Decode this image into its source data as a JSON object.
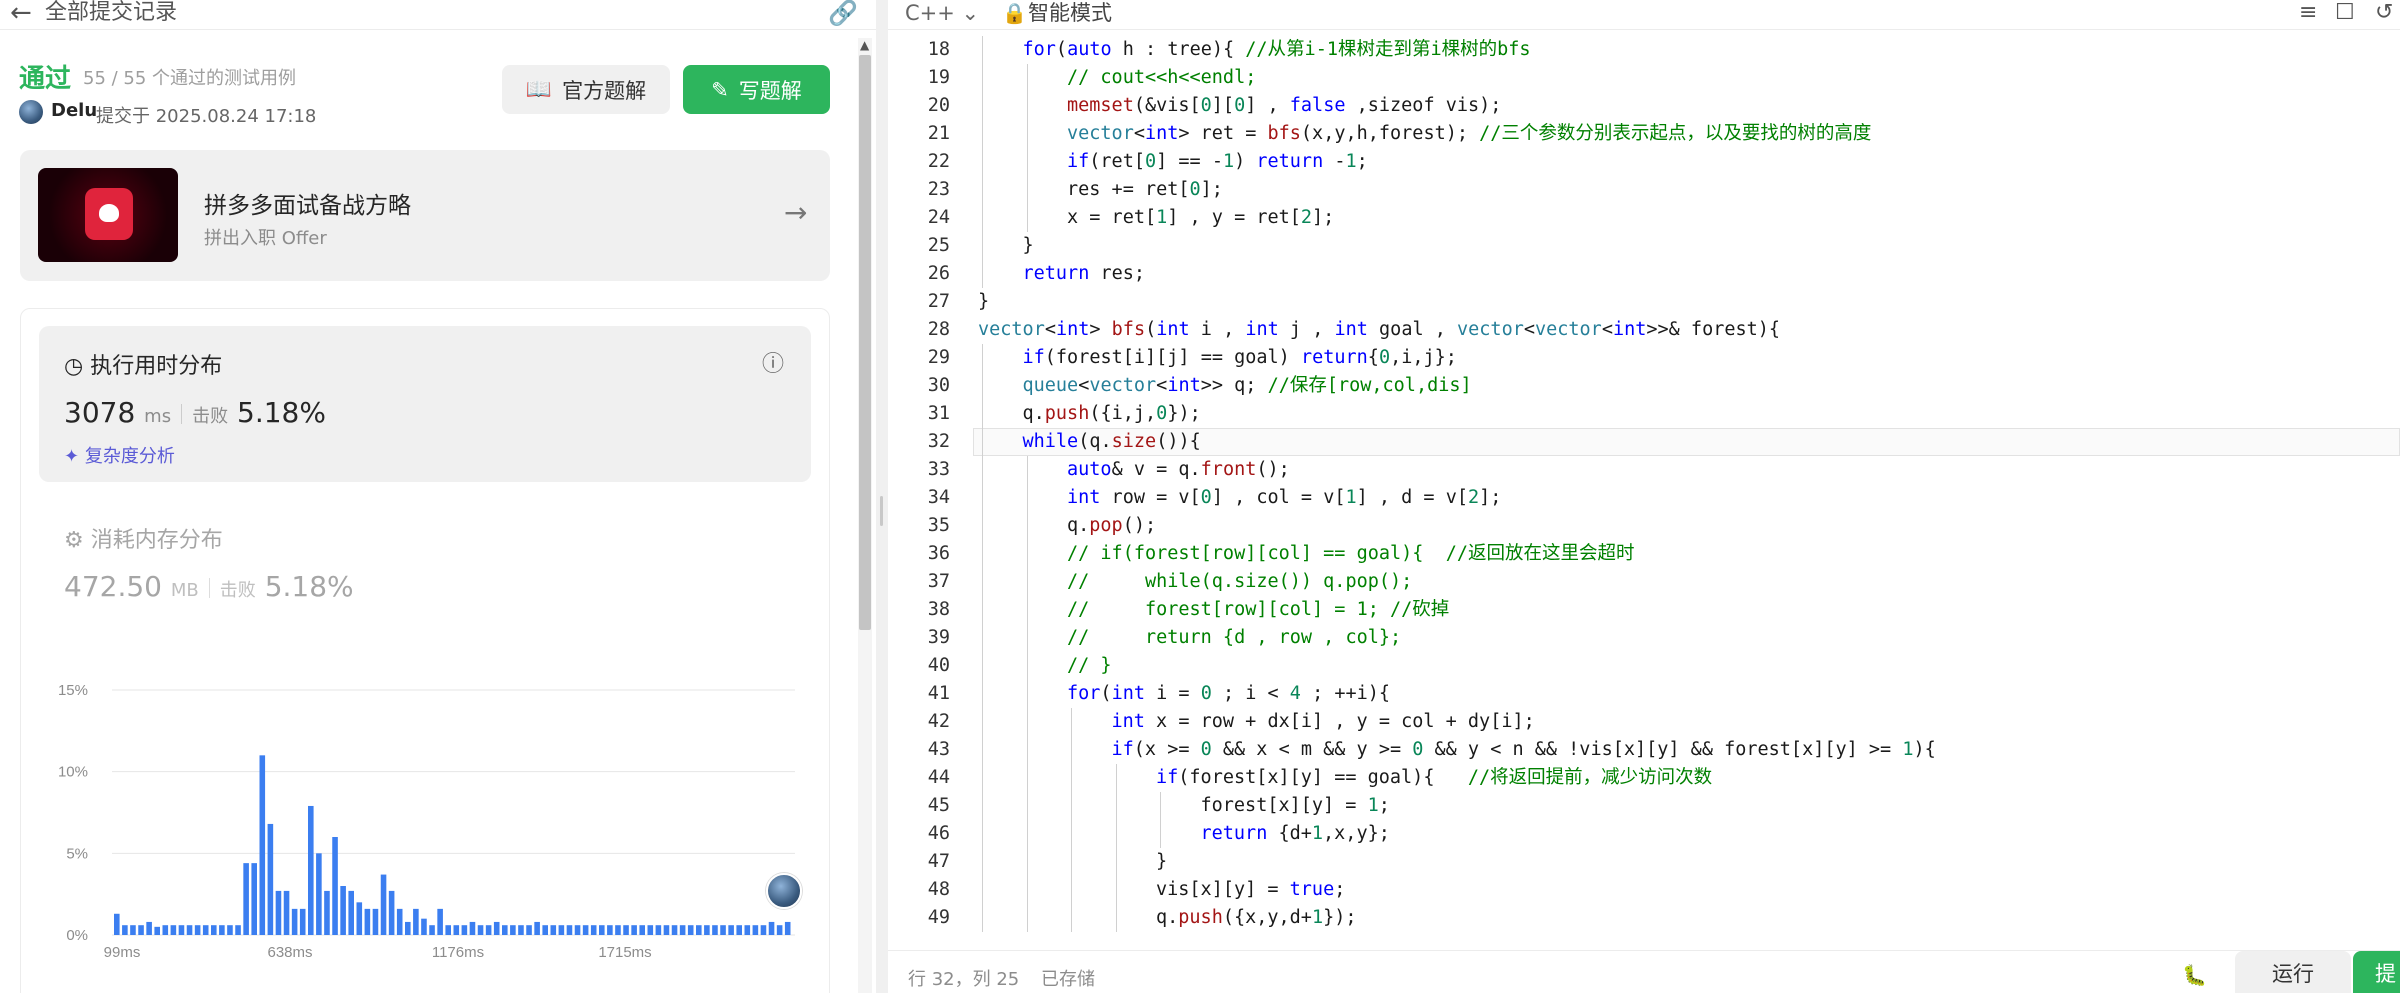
{
  "left_header": {
    "back_icon": "arrow-left-icon",
    "title": "全部提交记录",
    "link_icon": "link-icon"
  },
  "result": {
    "status": "通过",
    "passed_text": "55 / 55 个通过的测试用例",
    "author": "Delu",
    "submitted_at": "提交于 2025.08.24 17:18",
    "official_solution": "官方题解",
    "write_solution": "写题解",
    "accent_color": "#2db55d"
  },
  "ad": {
    "title": "拼多多面试备战方略",
    "subtitle": "拼出入职 Offer"
  },
  "runtime": {
    "heading": "执行用时分布",
    "value": "3078",
    "unit": "ms",
    "beat_label": "击败",
    "beat_pct": "5.18%",
    "complexity": "复杂度分析"
  },
  "memory": {
    "heading": "消耗内存分布",
    "value": "472.50",
    "unit": "MB",
    "beat_label": "击败",
    "beat_pct": "5.18%"
  },
  "chart_data": {
    "type": "bar",
    "y_tick_labels": [
      "0%",
      "5%",
      "10%",
      "15%"
    ],
    "ylim": [
      0,
      15
    ],
    "x_tick_labels": [
      "99ms",
      "638ms",
      "1176ms",
      "1715ms"
    ],
    "bar_color": "#3b7ef0",
    "values": [
      1.3,
      0.6,
      0.6,
      0.6,
      0.8,
      0.5,
      0.6,
      0.6,
      0.6,
      0.6,
      0.6,
      0.6,
      0.6,
      0.6,
      0.6,
      0.6,
      4.4,
      4.4,
      11,
      6.8,
      2.7,
      2.7,
      1.6,
      1.6,
      7.9,
      5,
      2.7,
      6,
      3,
      2.7,
      2,
      1.6,
      1.6,
      3.7,
      2.7,
      1.6,
      0.8,
      1.6,
      1,
      0.6,
      1.6,
      0.6,
      0.6,
      0.6,
      0.8,
      0.6,
      0.6,
      0.8,
      0.6,
      0.6,
      0.6,
      0.6,
      0.8,
      0.6,
      0.6,
      0.6,
      0.6,
      0.6,
      0.6,
      0.6,
      0.6,
      0.6,
      0.6,
      0.6,
      0.6,
      0.6,
      0.6,
      0.6,
      0.6,
      0.6,
      0.6,
      0.6,
      0.6,
      0.6,
      0.6,
      0.6,
      0.6,
      0.6,
      0.6,
      0.6,
      0.6,
      0.8,
      0.6,
      0.8
    ]
  },
  "editor": {
    "language": "C++",
    "mode": "智能模式",
    "position": "行 32，列 25",
    "saved": "已存储",
    "run": "运行",
    "submit": "提"
  },
  "code_lines": [
    {
      "no": "18",
      "ind": 1,
      "tokens": [
        [
          "k",
          "for"
        ],
        [
          "",
          "("
        ],
        [
          "k",
          "auto"
        ],
        [
          "",
          " h : tree){ "
        ],
        [
          "c",
          "//从第i-1棵树走到第i棵树的bfs"
        ]
      ]
    },
    {
      "no": "19",
      "ind": 2,
      "tokens": [
        [
          "c",
          "// cout<<h<<endl;"
        ]
      ]
    },
    {
      "no": "20",
      "ind": 2,
      "tokens": [
        [
          "s",
          "memset"
        ],
        [
          "",
          "(&vis["
        ],
        [
          "n",
          "0"
        ],
        [
          "",
          "]["
        ],
        [
          "n",
          "0"
        ],
        [
          "",
          "] , "
        ],
        [
          "k",
          "false"
        ],
        [
          "",
          " ,sizeof vis);"
        ]
      ]
    },
    {
      "no": "21",
      "ind": 2,
      "tokens": [
        [
          "t",
          "vector"
        ],
        [
          "",
          "<"
        ],
        [
          "k",
          "int"
        ],
        [
          "",
          "> ret = "
        ],
        [
          "s",
          "bfs"
        ],
        [
          "",
          "(x,y,h,forest); "
        ],
        [
          "c",
          "//三个参数分别表示起点，以及要找的树的高度"
        ]
      ]
    },
    {
      "no": "22",
      "ind": 2,
      "tokens": [
        [
          "k",
          "if"
        ],
        [
          "",
          "(ret["
        ],
        [
          "n",
          "0"
        ],
        [
          "",
          "] == -"
        ],
        [
          "n",
          "1"
        ],
        [
          "",
          ") "
        ],
        [
          "k",
          "return"
        ],
        [
          "",
          " -"
        ],
        [
          "n",
          "1"
        ],
        [
          "",
          ";"
        ]
      ]
    },
    {
      "no": "23",
      "ind": 2,
      "tokens": [
        [
          "",
          "res += ret["
        ],
        [
          "n",
          "0"
        ],
        [
          "",
          "];"
        ]
      ]
    },
    {
      "no": "24",
      "ind": 2,
      "tokens": [
        [
          "",
          "x = ret["
        ],
        [
          "n",
          "1"
        ],
        [
          "",
          "] , y = ret["
        ],
        [
          "n",
          "2"
        ],
        [
          "",
          "];"
        ]
      ]
    },
    {
      "no": "25",
      "ind": 1,
      "tokens": [
        [
          "",
          "}"
        ]
      ]
    },
    {
      "no": "26",
      "ind": 1,
      "tokens": [
        [
          "k",
          "return"
        ],
        [
          "",
          " res;"
        ]
      ]
    },
    {
      "no": "27",
      "ind": 0,
      "tokens": [
        [
          "",
          "}"
        ]
      ]
    },
    {
      "no": "28",
      "ind": 0,
      "tokens": [
        [
          "t",
          "vector"
        ],
        [
          "",
          "<"
        ],
        [
          "k",
          "int"
        ],
        [
          "",
          "> "
        ],
        [
          "s",
          "bfs"
        ],
        [
          "",
          "("
        ],
        [
          "k",
          "int"
        ],
        [
          "",
          " i , "
        ],
        [
          "k",
          "int"
        ],
        [
          "",
          " j , "
        ],
        [
          "k",
          "int"
        ],
        [
          "",
          " goal , "
        ],
        [
          "t",
          "vector"
        ],
        [
          "",
          "<"
        ],
        [
          "t",
          "vector"
        ],
        [
          "",
          "<"
        ],
        [
          "k",
          "int"
        ],
        [
          "",
          ">>& forest){"
        ]
      ]
    },
    {
      "no": "29",
      "ind": 1,
      "tokens": [
        [
          "k",
          "if"
        ],
        [
          "",
          "(forest[i][j] == goal) "
        ],
        [
          "k",
          "return"
        ],
        [
          "",
          "{"
        ],
        [
          "n",
          "0"
        ],
        [
          "",
          ",i,j};"
        ]
      ]
    },
    {
      "no": "30",
      "ind": 1,
      "tokens": [
        [
          "t",
          "queue"
        ],
        [
          "",
          "<"
        ],
        [
          "t",
          "vector"
        ],
        [
          "",
          "<"
        ],
        [
          "k",
          "int"
        ],
        [
          "",
          ">> q; "
        ],
        [
          "c",
          "//保存[row,col,dis]"
        ]
      ]
    },
    {
      "no": "31",
      "ind": 1,
      "tokens": [
        [
          "",
          "q."
        ],
        [
          "s",
          "push"
        ],
        [
          "",
          "({i,j,"
        ],
        [
          "n",
          "0"
        ],
        [
          "",
          "});"
        ]
      ]
    },
    {
      "no": "32",
      "ind": 1,
      "tokens": [
        [
          "k",
          "while"
        ],
        [
          "",
          "(q."
        ],
        [
          "s",
          "size"
        ],
        [
          "",
          "()){"
        ]
      ]
    },
    {
      "no": "33",
      "ind": 2,
      "tokens": [
        [
          "k",
          "auto"
        ],
        [
          "",
          "& v = q."
        ],
        [
          "s",
          "front"
        ],
        [
          "",
          "();"
        ]
      ]
    },
    {
      "no": "34",
      "ind": 2,
      "tokens": [
        [
          "k",
          "int"
        ],
        [
          "",
          " row = v["
        ],
        [
          "n",
          "0"
        ],
        [
          "",
          "] , col = v["
        ],
        [
          "n",
          "1"
        ],
        [
          "",
          "] , d = v["
        ],
        [
          "n",
          "2"
        ],
        [
          "",
          "];"
        ]
      ]
    },
    {
      "no": "35",
      "ind": 2,
      "tokens": [
        [
          "",
          "q."
        ],
        [
          "s",
          "pop"
        ],
        [
          "",
          "();"
        ]
      ]
    },
    {
      "no": "36",
      "ind": 2,
      "tokens": [
        [
          "c",
          "// if(forest[row][col] == goal){  //返回放在这里会超时"
        ]
      ]
    },
    {
      "no": "37",
      "ind": 2,
      "tokens": [
        [
          "c",
          "//     while(q.size()) q.pop();"
        ]
      ]
    },
    {
      "no": "38",
      "ind": 2,
      "tokens": [
        [
          "c",
          "//     forest[row][col] = 1; //砍掉"
        ]
      ]
    },
    {
      "no": "39",
      "ind": 2,
      "tokens": [
        [
          "c",
          "//     return {d , row , col};"
        ]
      ]
    },
    {
      "no": "40",
      "ind": 2,
      "tokens": [
        [
          "c",
          "// }"
        ]
      ]
    },
    {
      "no": "41",
      "ind": 2,
      "tokens": [
        [
          "k",
          "for"
        ],
        [
          "",
          "("
        ],
        [
          "k",
          "int"
        ],
        [
          "",
          " i = "
        ],
        [
          "n",
          "0"
        ],
        [
          "",
          " ; i < "
        ],
        [
          "n",
          "4"
        ],
        [
          "",
          " ; ++i){"
        ]
      ]
    },
    {
      "no": "42",
      "ind": 3,
      "tokens": [
        [
          "k",
          "int"
        ],
        [
          "",
          " x = row + dx[i] , y = col + dy[i];"
        ]
      ]
    },
    {
      "no": "43",
      "ind": 3,
      "tokens": [
        [
          "k",
          "if"
        ],
        [
          "",
          "(x >= "
        ],
        [
          "n",
          "0"
        ],
        [
          "",
          " && x < m && y >= "
        ],
        [
          "n",
          "0"
        ],
        [
          "",
          " && y < n && !vis[x][y] && forest[x][y] >= "
        ],
        [
          "n",
          "1"
        ],
        [
          "",
          "){"
        ]
      ]
    },
    {
      "no": "44",
      "ind": 4,
      "tokens": [
        [
          "k",
          "if"
        ],
        [
          "",
          "(forest[x][y] == goal){   "
        ],
        [
          "c",
          "//将返回提前，减少访问次数"
        ]
      ]
    },
    {
      "no": "45",
      "ind": 5,
      "tokens": [
        [
          "",
          "forest[x][y] = "
        ],
        [
          "n",
          "1"
        ],
        [
          "",
          ";"
        ]
      ]
    },
    {
      "no": "46",
      "ind": 5,
      "tokens": [
        [
          "k",
          "return"
        ],
        [
          "",
          " {d+"
        ],
        [
          "n",
          "1"
        ],
        [
          "",
          ",x,y};"
        ]
      ]
    },
    {
      "no": "47",
      "ind": 4,
      "tokens": [
        [
          "",
          "}"
        ]
      ]
    },
    {
      "no": "48",
      "ind": 4,
      "tokens": [
        [
          "",
          "vis[x][y] = "
        ],
        [
          "k",
          "true"
        ],
        [
          "",
          ";"
        ]
      ]
    },
    {
      "no": "49",
      "ind": 4,
      "tokens": [
        [
          "",
          "q."
        ],
        [
          "s",
          "push"
        ],
        [
          "",
          "({x,y,d+"
        ],
        [
          "n",
          "1"
        ],
        [
          "",
          "});"
        ]
      ]
    }
  ]
}
